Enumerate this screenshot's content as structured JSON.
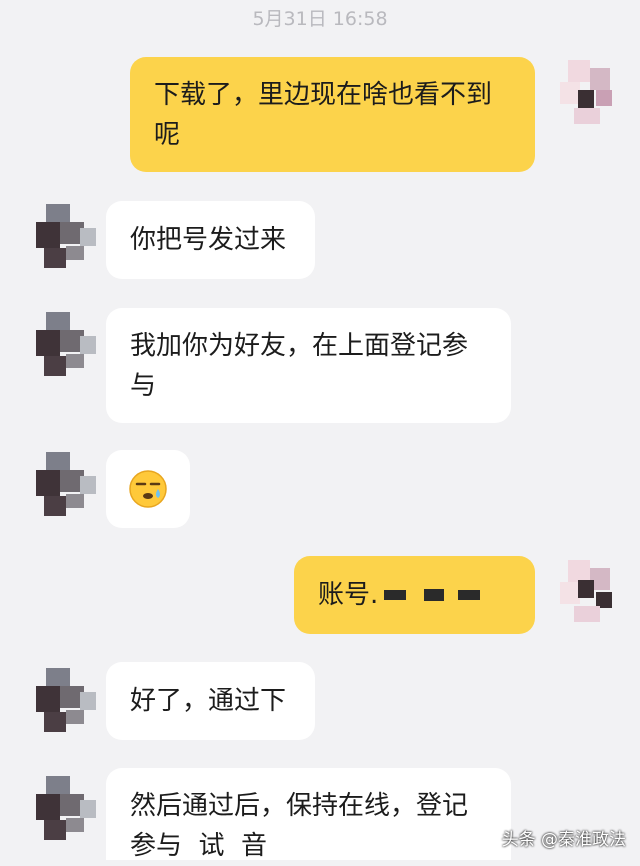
{
  "header": {
    "timestamp": "5月31日 16:58"
  },
  "messages": [
    {
      "side": "me",
      "text": "下载了，里边现在啥也看不到\n呢"
    },
    {
      "side": "them",
      "text": "你把号发过来"
    },
    {
      "side": "them",
      "text": "我加你为好友，在上面登记参\n与"
    },
    {
      "side": "them",
      "emoji": "sleepy-emoji"
    },
    {
      "side": "me",
      "text": "账号."
    },
    {
      "side": "them",
      "text": "好了，通过下"
    },
    {
      "side": "them",
      "text": "然后通过后，保持在线，登记\n参与  试  音"
    }
  ],
  "watermark": "头条 @秦淮政法",
  "colors": {
    "background": "#f2f2f4",
    "my_bubble": "#fcd34b",
    "their_bubble": "#ffffff"
  }
}
